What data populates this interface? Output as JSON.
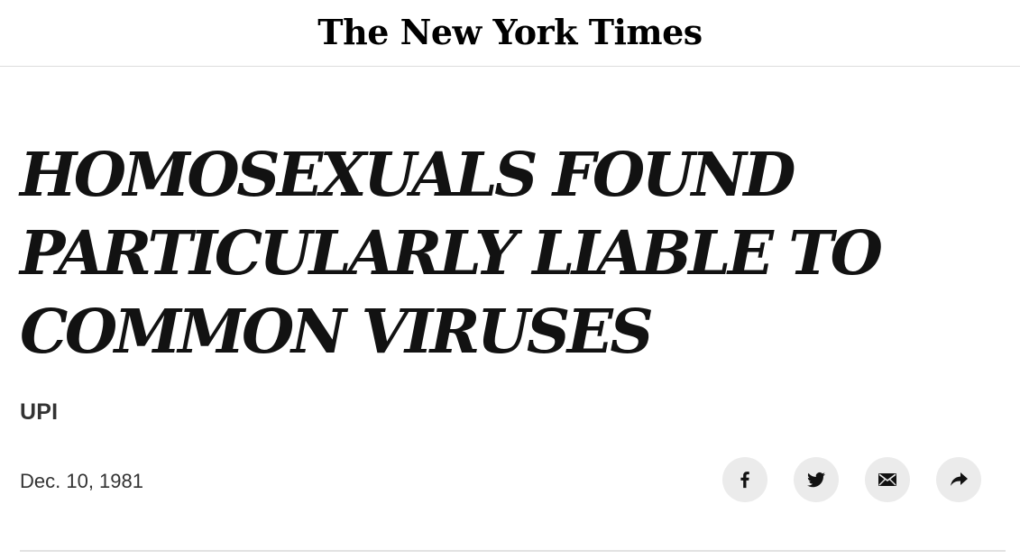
{
  "masthead": {
    "logo_text": "The New York Times"
  },
  "article": {
    "headline": "HOMOSEXUALS FOUND PARTICULARLY LIABLE TO COMMON VIRUSES",
    "byline": "UPI",
    "date": "Dec. 10, 1981"
  },
  "share_tools": {
    "buttons": [
      {
        "icon": "facebook-icon"
      },
      {
        "icon": "twitter-icon"
      },
      {
        "icon": "email-icon"
      },
      {
        "icon": "share-arrow-icon"
      }
    ]
  },
  "colors": {
    "text": "#121212",
    "secondary_text": "#333333",
    "share_button_bg": "#ebebeb",
    "divider": "#dcdcdc"
  }
}
